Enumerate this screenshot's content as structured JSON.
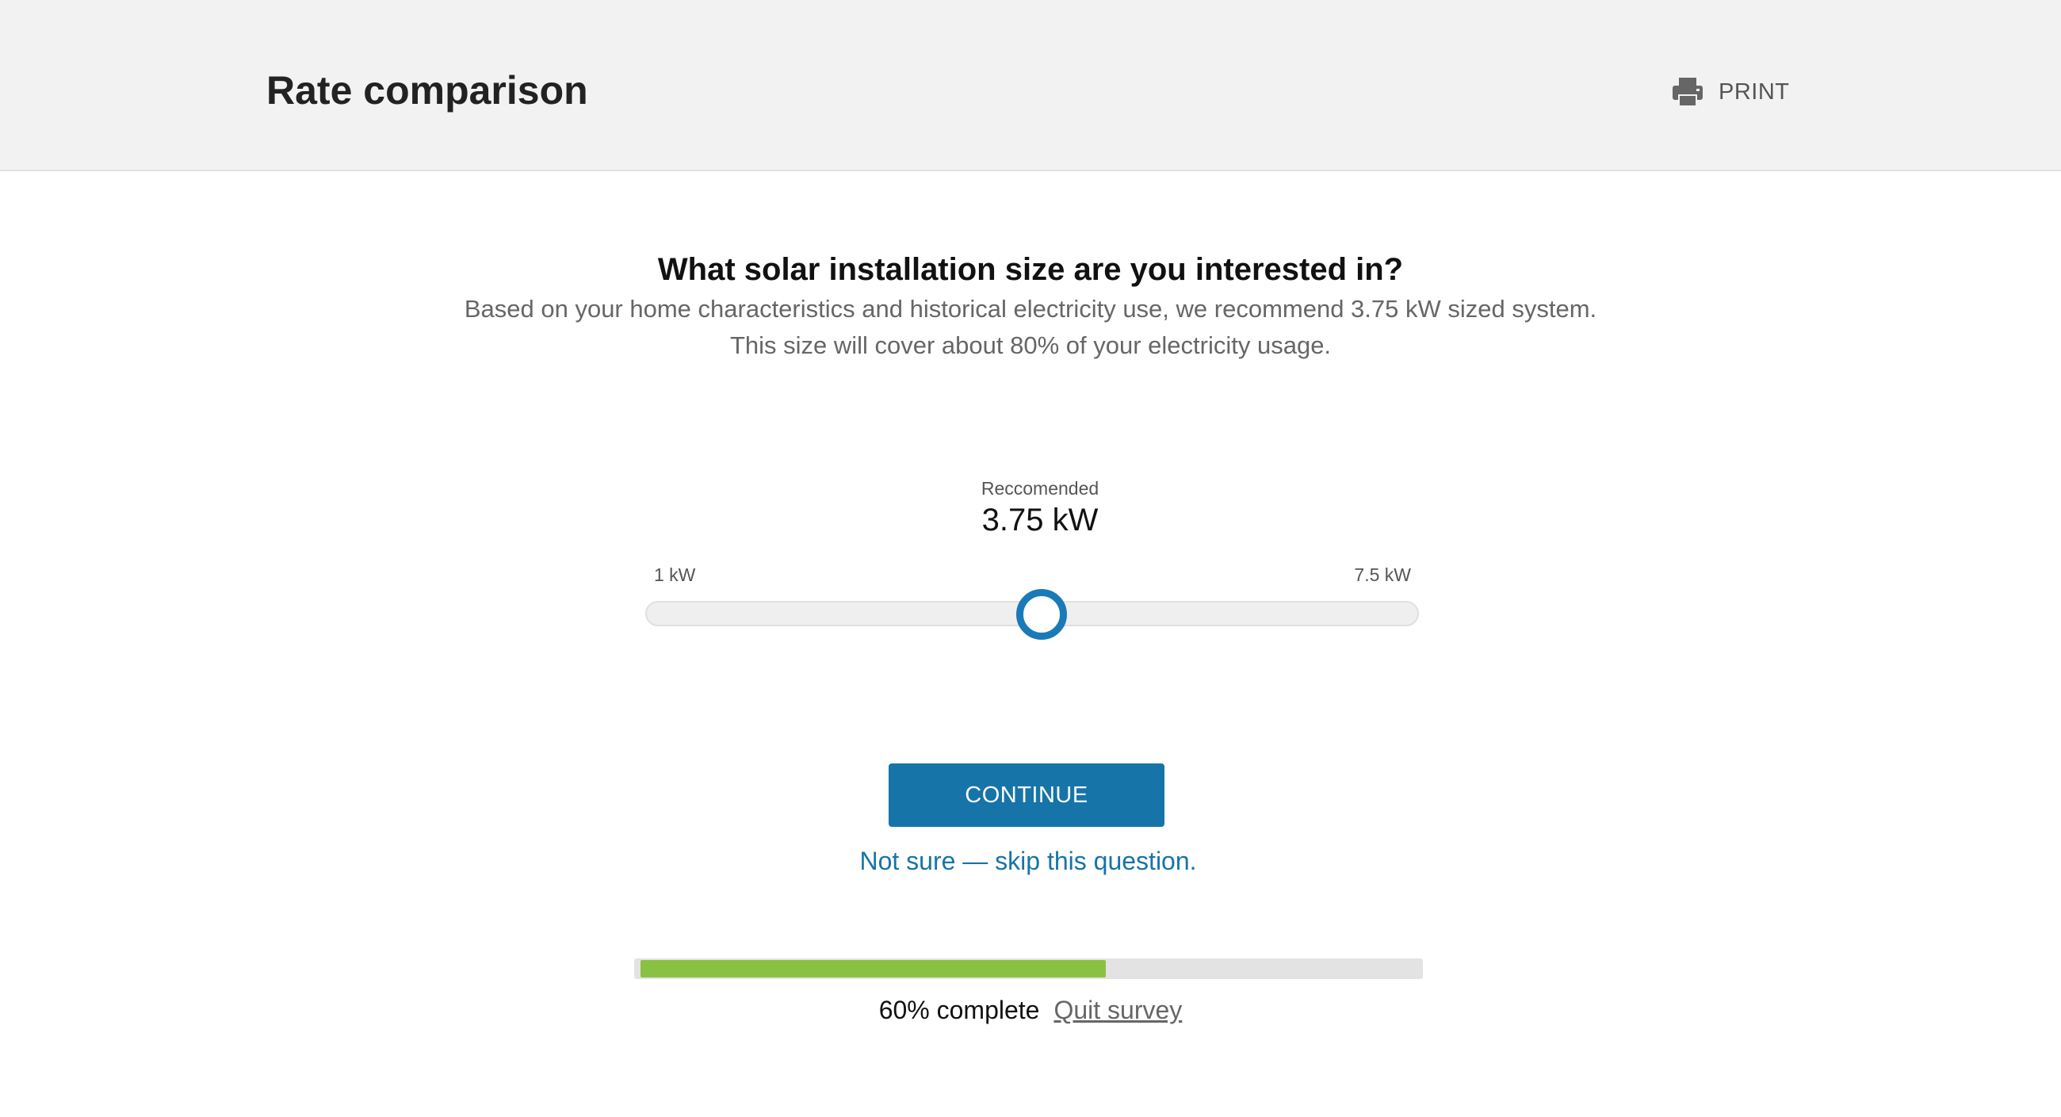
{
  "header": {
    "title": "Rate comparison",
    "print_label": "PRINT",
    "print_icon": "printer-icon"
  },
  "question": {
    "title": "What solar installation size are you interested in?",
    "description_line1": "Based on your home characteristics and historical electricity use, we recommend 3.75 kW sized system.",
    "description_line2": "This size will cover about 80% of your electricity usage."
  },
  "slider": {
    "label": "Reccomended",
    "value_text": "3.75 kW",
    "min_label": "1 kW",
    "max_label": "7.5 kW",
    "min": 1,
    "max": 7.5,
    "value": 3.75,
    "accent_color": "#1a7ab8"
  },
  "actions": {
    "continue_label": "CONTINUE",
    "skip_label": "Not sure — skip this question.",
    "button_color": "#1674a9"
  },
  "progress": {
    "percent": 60,
    "complete_text": "60% complete",
    "quit_label": "Quit survey",
    "fill_color": "#8bc142"
  }
}
